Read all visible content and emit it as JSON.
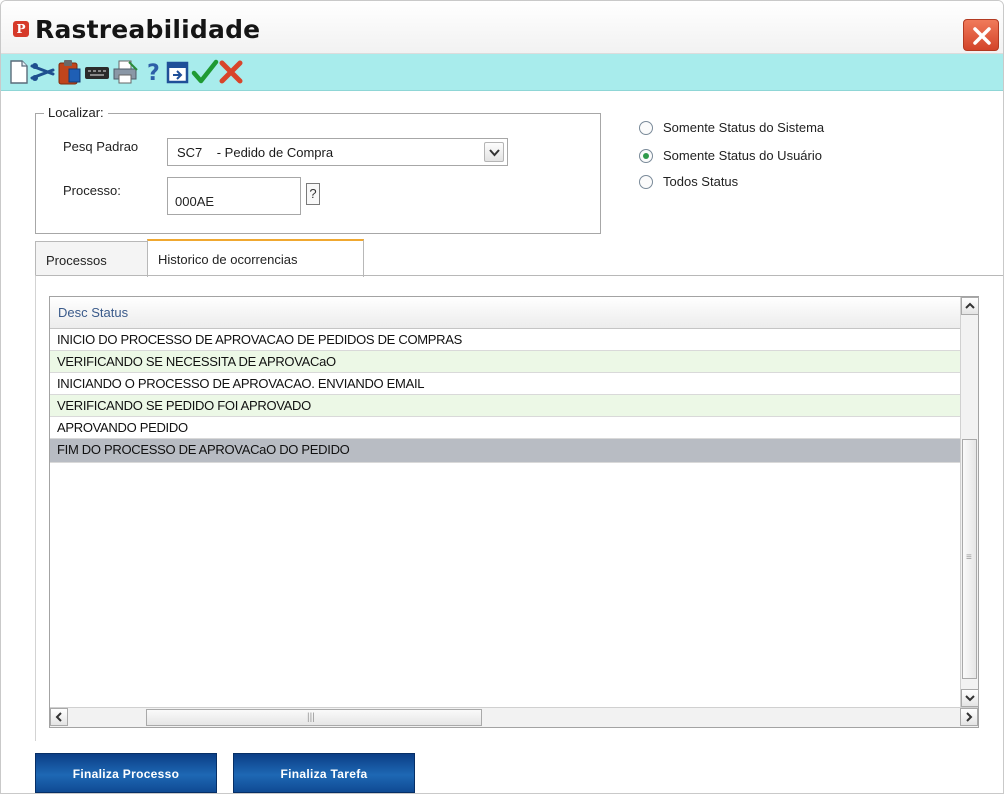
{
  "window": {
    "title": "Rastreabilidade"
  },
  "toolbar": {
    "icons": [
      "new-icon",
      "cut-icon",
      "clipboard-icon",
      "keyboard-icon",
      "print-icon",
      "help-icon",
      "window-icon",
      "confirm-check-icon",
      "cancel-x-icon"
    ]
  },
  "search": {
    "legend": "Localizar:",
    "pesq_label": "Pesq Padrao",
    "pesq_value": "SC7    - Pedido de Compra",
    "processo_label": "Processo:",
    "processo_value": "000AE",
    "help_label": "?"
  },
  "status_filter": {
    "options": [
      {
        "label": "Somente Status do Sistema",
        "checked": false
      },
      {
        "label": "Somente Status do Usuário",
        "checked": true
      },
      {
        "label": "Todos Status",
        "checked": false
      }
    ]
  },
  "tabs": [
    {
      "label": "Processos",
      "active": false
    },
    {
      "label": "Historico de ocorrencias",
      "active": true
    }
  ],
  "grid": {
    "column_header": "Desc Status",
    "rows": [
      "INICIO DO PROCESSO DE APROVACAO DE PEDIDOS DE COMPRAS",
      "VERIFICANDO SE NECESSITA DE APROVACaO",
      "INICIANDO O PROCESSO DE APROVACAO. ENVIANDO EMAIL",
      "VERIFICANDO SE PEDIDO FOI APROVADO",
      "APROVANDO PEDIDO",
      "FIM DO PROCESSO DE APROVACaO DO PEDIDO"
    ],
    "selected_row": 5
  },
  "buttons": {
    "finaliza_processo": "Finaliza Processo",
    "finaliza_tarefa": "Finaliza Tarefa"
  },
  "colors": {
    "toolbar_bg": "#a8ecec",
    "alt_row": "#ecf8e6",
    "selected_row": "#b8bcc3",
    "button_blue": "#1e68b4",
    "tab_accent": "#f0a830"
  }
}
